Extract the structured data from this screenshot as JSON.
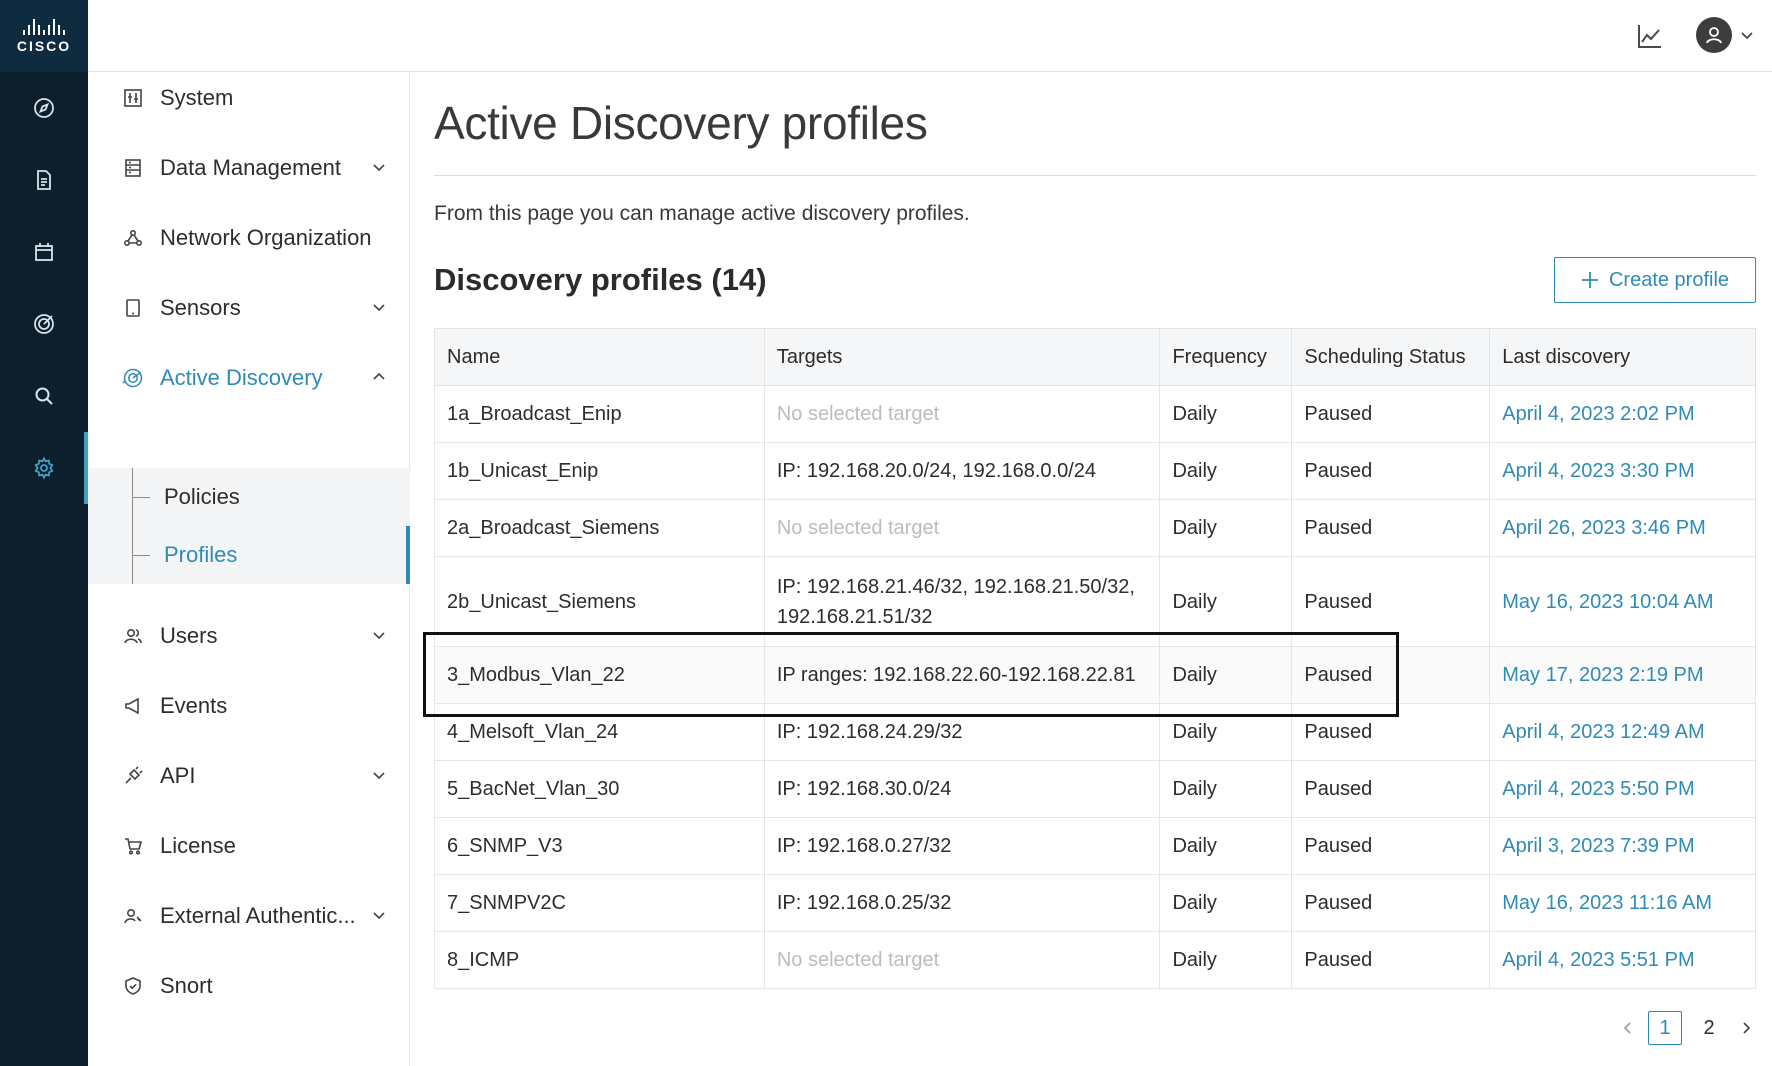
{
  "brand": {
    "logo_text": "CISCO"
  },
  "rail": {
    "items": [
      {
        "icon": "compass-icon"
      },
      {
        "icon": "document-icon"
      },
      {
        "icon": "calendar-icon"
      },
      {
        "icon": "target-icon"
      },
      {
        "icon": "search-icon"
      },
      {
        "icon": "gear-icon",
        "active": true
      }
    ]
  },
  "header": {
    "chart_icon": "line-chart-icon",
    "avatar_icon": "user-avatar-icon"
  },
  "sidebar": {
    "items": [
      {
        "label": "System",
        "icon": "sliders-icon"
      },
      {
        "label": "Data Management",
        "icon": "database-icon",
        "expandable": true
      },
      {
        "label": "Network Organization",
        "icon": "network-icon"
      },
      {
        "label": "Sensors",
        "icon": "tablet-icon",
        "expandable": true
      },
      {
        "label": "Active Discovery",
        "icon": "radar-icon",
        "expanded": true,
        "active": true
      },
      {
        "label": "Users",
        "icon": "users-icon",
        "expandable": true
      },
      {
        "label": "Events",
        "icon": "megaphone-icon"
      },
      {
        "label": "API",
        "icon": "plug-icon",
        "expandable": true
      },
      {
        "label": "License",
        "icon": "cart-icon"
      },
      {
        "label": "External Authentic...",
        "icon": "user-key-icon",
        "expandable": true
      },
      {
        "label": "Snort",
        "icon": "shield-icon"
      }
    ],
    "sub_items": [
      {
        "label": "Policies"
      },
      {
        "label": "Profiles",
        "active": true
      }
    ]
  },
  "main": {
    "title": "Active Discovery profiles",
    "description": "From this page you can manage active discovery profiles.",
    "section_title": "Discovery profiles (14)",
    "create_button": "Create profile",
    "table": {
      "columns": [
        "Name",
        "Targets",
        "Frequency",
        "Scheduling Status",
        "Last discovery"
      ],
      "rows": [
        {
          "name": "1a_Broadcast_Enip",
          "targets": "No selected target",
          "frequency": "Daily",
          "status": "Paused",
          "last": "April 4, 2023 2:02 PM"
        },
        {
          "name": "1b_Unicast_Enip",
          "targets": "IP: 192.168.20.0/24, 192.168.0.0/24",
          "frequency": "Daily",
          "status": "Paused",
          "last": "April 4, 2023 3:30 PM"
        },
        {
          "name": "2a_Broadcast_Siemens",
          "targets": "No selected target",
          "frequency": "Daily",
          "status": "Paused",
          "last": "April 26, 2023 3:46 PM"
        },
        {
          "name": "2b_Unicast_Siemens",
          "targets": "IP: 192.168.21.46/32, 192.168.21.50/32, 192.168.21.51/32",
          "frequency": "Daily",
          "status": "Paused",
          "last": "May 16, 2023 10:04 AM"
        },
        {
          "name": "3_Modbus_Vlan_22",
          "targets": "IP ranges: 192.168.22.60-192.168.22.81",
          "frequency": "Daily",
          "status": "Paused",
          "last": "May 17, 2023 2:19 PM"
        },
        {
          "name": "4_Melsoft_Vlan_24",
          "targets": "IP: 192.168.24.29/32",
          "frequency": "Daily",
          "status": "Paused",
          "last": "April 4, 2023 12:49 AM"
        },
        {
          "name": "5_BacNet_Vlan_30",
          "targets": "IP: 192.168.30.0/24",
          "frequency": "Daily",
          "status": "Paused",
          "last": "April 4, 2023 5:50 PM"
        },
        {
          "name": "6_SNMP_V3",
          "targets": "IP: 192.168.0.27/32",
          "frequency": "Daily",
          "status": "Paused",
          "last": "April 3, 2023 7:39 PM"
        },
        {
          "name": "7_SNMPV2C",
          "targets": "IP: 192.168.0.25/32",
          "frequency": "Daily",
          "status": "Paused",
          "last": "May 16, 2023 11:16 AM"
        },
        {
          "name": "8_ICMP",
          "targets": "No selected target",
          "frequency": "Daily",
          "status": "Paused",
          "last": "April 4, 2023 5:51 PM"
        }
      ]
    },
    "pagination": {
      "pages": [
        "1",
        "2"
      ],
      "current": "1"
    }
  },
  "colors": {
    "accent": "#2f8bb5",
    "rail_bg": "#0d1f2d",
    "muted_text": "#bcbcbc"
  }
}
